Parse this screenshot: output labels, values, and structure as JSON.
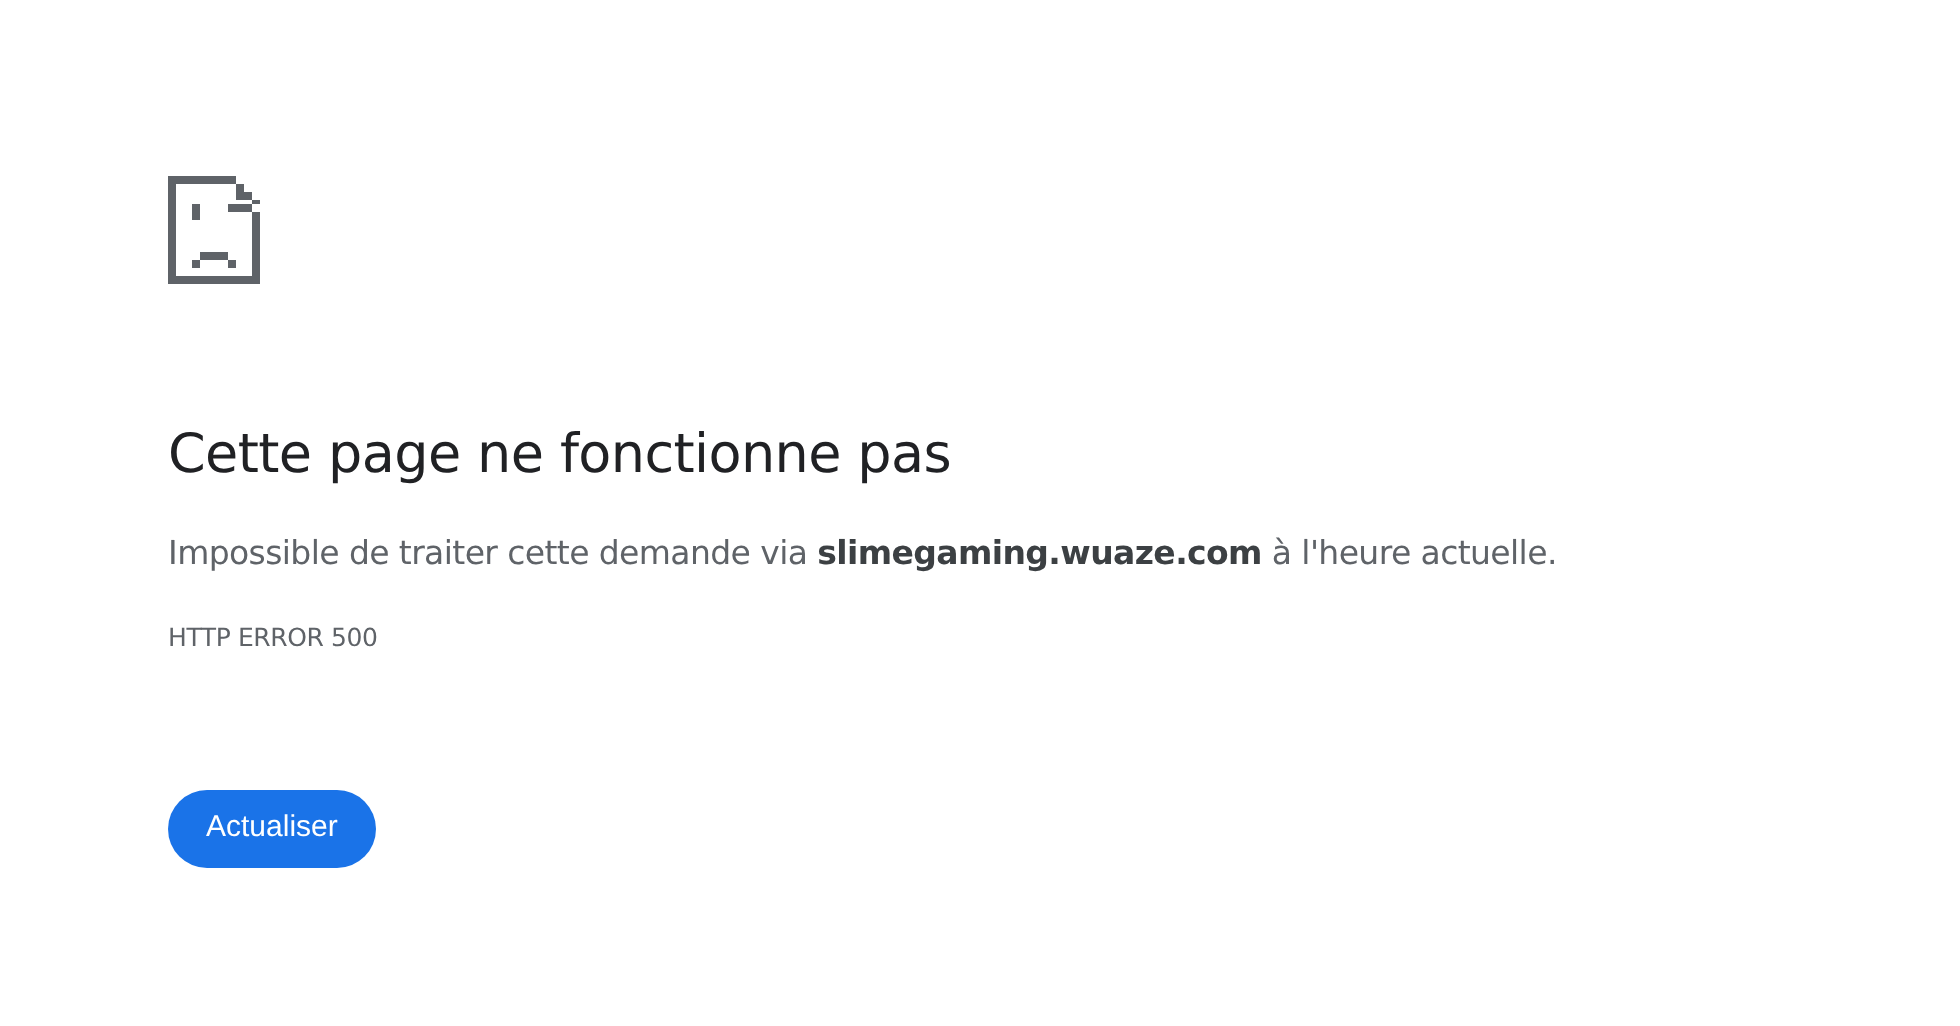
{
  "heading": "Cette page ne fonctionne pas",
  "message": "Impossible de traiter cette demande via **slimegaming.wuaze.com** à l'heure actuelle.",
  "error_code": "HTTP ERROR 500",
  "buttons": [
    "Actualiser"
  ]
}
